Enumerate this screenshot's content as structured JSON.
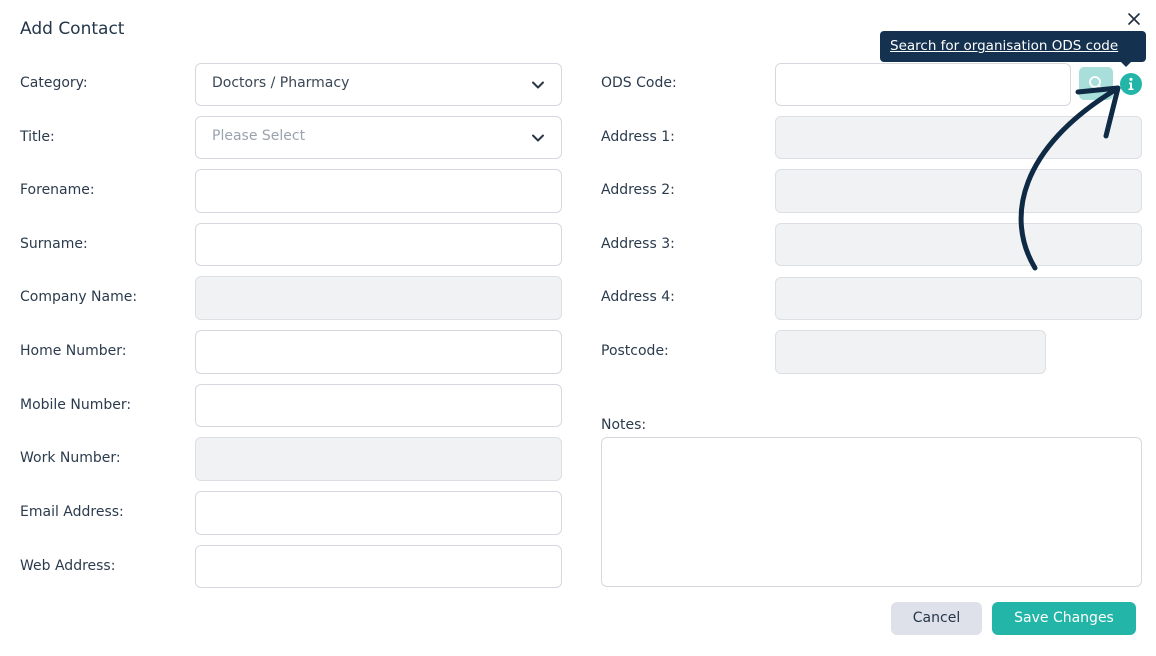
{
  "dialog": {
    "title": "Add Contact"
  },
  "left_fields": [
    {
      "label": "Category:",
      "value": "Doctors / Pharmacy",
      "type": "select"
    },
    {
      "label": "Title:",
      "placeholder": "Please Select",
      "type": "select"
    },
    {
      "label": "Forename:",
      "value": "",
      "type": "text"
    },
    {
      "label": "Surname:",
      "value": "",
      "type": "text"
    },
    {
      "label": "Company Name:",
      "value": "",
      "type": "disabled"
    },
    {
      "label": "Home Number:",
      "value": "",
      "type": "text"
    },
    {
      "label": "Mobile Number:",
      "value": "",
      "type": "text"
    },
    {
      "label": "Work Number:",
      "value": "",
      "type": "disabled"
    },
    {
      "label": "Email Address:",
      "value": "",
      "type": "text"
    },
    {
      "label": "Web Address:",
      "value": "",
      "type": "text"
    }
  ],
  "right_fields": [
    {
      "label": "ODS Code:",
      "value": "",
      "type": "text"
    },
    {
      "label": "Address 1:",
      "value": "",
      "type": "disabled"
    },
    {
      "label": "Address 2:",
      "value": "",
      "type": "disabled"
    },
    {
      "label": "Address 3:",
      "value": "",
      "type": "disabled"
    },
    {
      "label": "Address 4:",
      "value": "",
      "type": "disabled"
    },
    {
      "label": "Postcode:",
      "value": "",
      "type": "disabled"
    },
    {
      "label": "Notes:",
      "value": "",
      "type": "textarea"
    }
  ],
  "tooltip": {
    "text": "Search for organisation ODS code"
  },
  "icons": {
    "close": "close-icon",
    "search": "search-icon",
    "info": "info-icon",
    "chevron": "chevron-down-icon"
  },
  "buttons": {
    "cancel": "Cancel",
    "save": "Save Changes"
  },
  "colors": {
    "accent": "#23b6a8",
    "tooltip_bg": "#14314f",
    "disabled_bg": "#f1f2f4"
  }
}
